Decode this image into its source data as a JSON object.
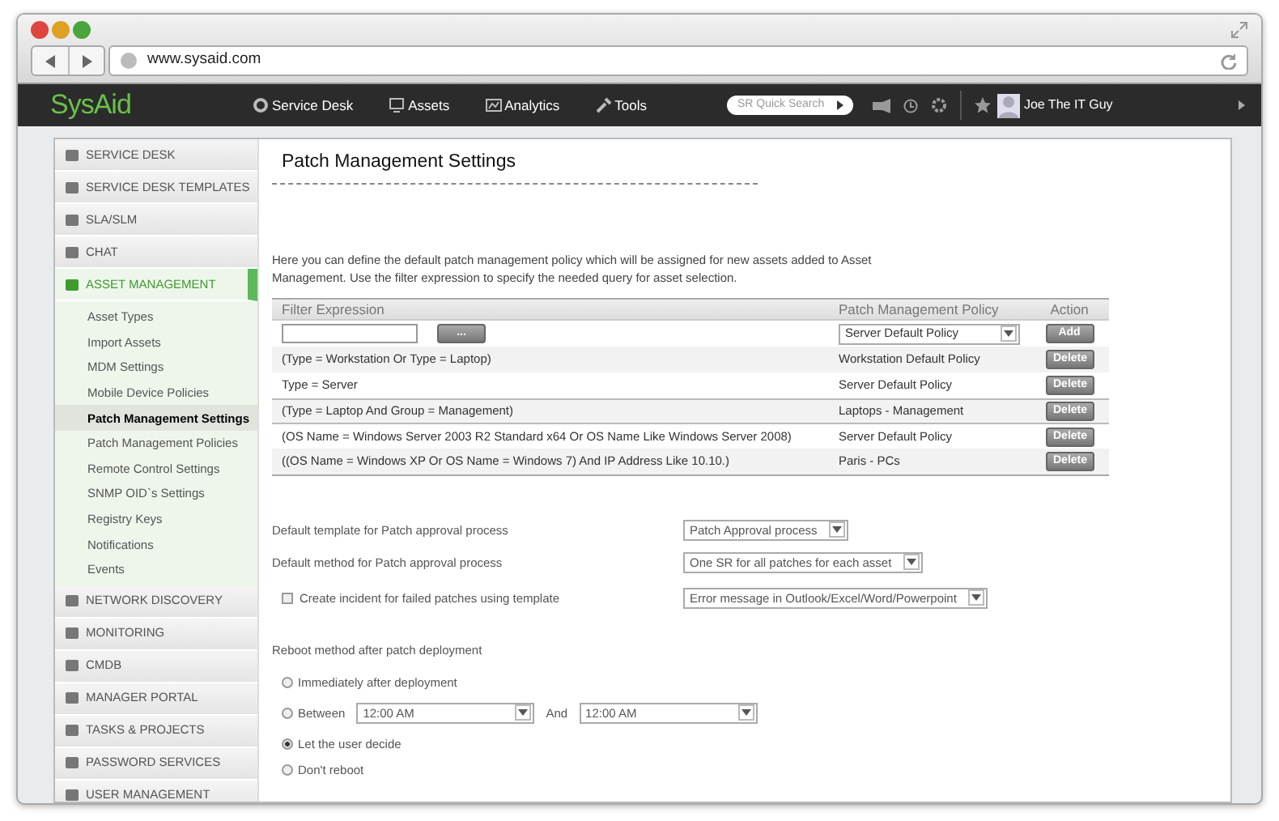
{
  "browser": {
    "url": "www.sysaid.com"
  },
  "app": {
    "logo": "SysAid",
    "nav": [
      {
        "label": "Service Desk"
      },
      {
        "label": "Assets"
      },
      {
        "label": "Analytics"
      },
      {
        "label": "Tools"
      }
    ],
    "search_placeholder": "SR Quick Search",
    "user": "Joe The IT Guy"
  },
  "sidebar": {
    "items": [
      {
        "label": "SERVICE DESK",
        "selected": false
      },
      {
        "label": "SERVICE DESK TEMPLATES",
        "selected": false
      },
      {
        "label": "SLA/SLM",
        "selected": false
      },
      {
        "label": "CHAT",
        "selected": false
      },
      {
        "label": "ASSET MANAGEMENT",
        "selected": true,
        "children": [
          {
            "label": "Asset Types",
            "selected": false
          },
          {
            "label": "Import Assets",
            "selected": false
          },
          {
            "label": "MDM Settings",
            "selected": false
          },
          {
            "label": "Mobile Device Policies",
            "selected": false
          },
          {
            "label": "Patch Management Settings",
            "selected": true
          },
          {
            "label": "Patch Management Policies",
            "selected": false
          },
          {
            "label": "Remote Control Settings",
            "selected": false
          },
          {
            "label": "SNMP OID`s Settings",
            "selected": false
          },
          {
            "label": "Registry Keys",
            "selected": false
          },
          {
            "label": "Notifications",
            "selected": false
          },
          {
            "label": "Events",
            "selected": false
          }
        ]
      },
      {
        "label": "NETWORK DISCOVERY",
        "selected": false
      },
      {
        "label": "MONITORING",
        "selected": false
      },
      {
        "label": "CMDB",
        "selected": false
      },
      {
        "label": "MANAGER PORTAL",
        "selected": false
      },
      {
        "label": "TASKS & PROJECTS",
        "selected": false
      },
      {
        "label": "PASSWORD SERVICES",
        "selected": false
      },
      {
        "label": "USER MANAGEMENT",
        "selected": false
      }
    ]
  },
  "page": {
    "title": "Patch Management Settings",
    "description": "Here you can define the default patch management policy which will be assigned for new assets added to Asset Management. Use the filter expression to specify the needed query for asset selection."
  },
  "table": {
    "columns": [
      "Filter Expression",
      "Patch Management Policy",
      "Action"
    ],
    "new_row": {
      "browse_button": "...",
      "policy": "Server Default Policy",
      "add_button": "Add"
    },
    "rows": [
      {
        "filter": "(Type = Workstation Or Type = Laptop)",
        "policy": "Workstation Default Policy",
        "action": "Delete"
      },
      {
        "filter": "Type = Server",
        "policy": "Server Default Policy",
        "action": "Delete"
      },
      {
        "filter": "(Type = Laptop And Group = Management)",
        "policy": "Laptops - Management",
        "action": "Delete"
      },
      {
        "filter": "(OS Name = Windows Server 2003 R2 Standard x64 Or OS Name Like Windows Server 2008)",
        "policy": "Server Default Policy",
        "action": "Delete"
      },
      {
        "filter": "((OS Name = Windows XP Or OS Name = Windows 7) And IP Address Like 10.10.)",
        "policy": "Paris - PCs",
        "action": "Delete"
      }
    ]
  },
  "settings": [
    {
      "kind": "select",
      "label": "Default template for Patch approval process",
      "value": "Patch Approval process"
    },
    {
      "kind": "select",
      "label": "Default method for Patch approval process",
      "value": "One SR for all patches for each asset"
    },
    {
      "kind": "checkbox",
      "label": "Create incident for failed patches using template",
      "checked": false,
      "value": "Error message in Outlook/Excel/Word/Powerpoint"
    }
  ],
  "reboot": {
    "label": "Reboot method after patch deployment",
    "options": [
      {
        "kind": "plain",
        "label": "Immediately after deployment",
        "selected": false
      },
      {
        "kind": "range",
        "label": "Between",
        "selected": false,
        "from": "12:00 AM",
        "joiner": "And",
        "to": "12:00 AM"
      },
      {
        "kind": "plain",
        "label": "Let the user decide",
        "selected": true
      },
      {
        "kind": "plain",
        "label": "Don't reboot",
        "selected": false
      }
    ]
  }
}
